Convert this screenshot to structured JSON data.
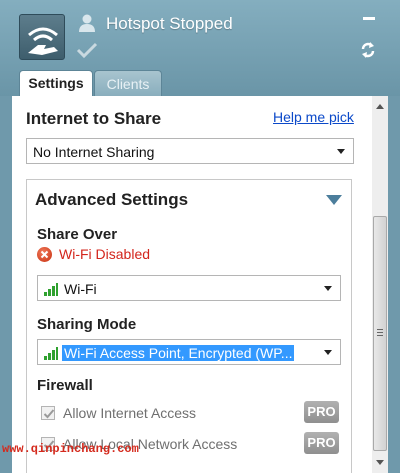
{
  "header": {
    "status_title": "Hotspot Stopped",
    "accent_color": "#6f99ab"
  },
  "tabs": [
    {
      "label": "Settings",
      "active": true
    },
    {
      "label": "Clients",
      "active": false
    }
  ],
  "internet_share": {
    "title": "Internet to Share",
    "help_link": "Help me pick",
    "selected": "No Internet Sharing"
  },
  "advanced": {
    "title": "Advanced Settings",
    "share_over": {
      "title": "Share Over",
      "error_text": "Wi-Fi Disabled",
      "selected": "Wi-Fi"
    },
    "sharing_mode": {
      "title": "Sharing Mode",
      "selected": "Wi-Fi Access Point, Encrypted (WP..."
    },
    "firewall": {
      "title": "Firewall",
      "options": [
        {
          "label": "Allow Internet Access",
          "checked": true,
          "badge": "PRO"
        },
        {
          "label": "Allow Local Network Access",
          "checked": true,
          "badge": "PRO"
        }
      ]
    }
  },
  "watermark": "www.qinpinchang.com",
  "icons": [
    "app-logo-icon",
    "user-icon",
    "checkmark-icon",
    "minimize-icon",
    "refresh-icon",
    "error-icon",
    "signal-icon",
    "collapse-triangle-icon"
  ]
}
